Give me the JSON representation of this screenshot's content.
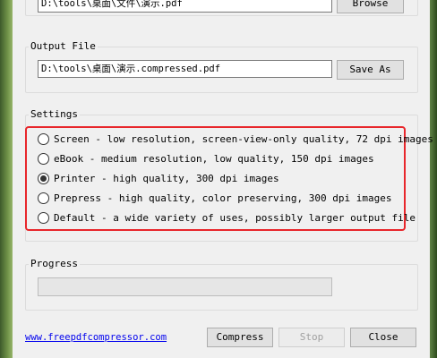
{
  "input": {
    "path_value": "D:\\tools\\桌面\\文件\\演示.pdf",
    "browse_label": "Browse"
  },
  "output": {
    "section_label": "Output File",
    "path_value": "D:\\tools\\桌面\\演示.compressed.pdf",
    "save_as_label": "Save As"
  },
  "settings": {
    "section_label": "Settings",
    "options": [
      {
        "label": "Screen - low resolution, screen-view-only quality, 72 dpi images",
        "checked": false
      },
      {
        "label": "eBook - medium resolution, low quality, 150 dpi images",
        "checked": false
      },
      {
        "label": "Printer - high quality, 300 dpi images",
        "checked": true
      },
      {
        "label": "Prepress - high quality, color preserving, 300 dpi images",
        "checked": false
      },
      {
        "label": "Default - a wide variety of uses, possibly larger output file",
        "checked": false
      }
    ]
  },
  "progress": {
    "section_label": "Progress",
    "value": 0
  },
  "footer": {
    "link_text": "www.freepdfcompressor.com",
    "compress_label": "Compress",
    "stop_label": "Stop",
    "close_label": "Close"
  },
  "colors": {
    "highlight": "#e8262b",
    "link": "#0000ee"
  }
}
